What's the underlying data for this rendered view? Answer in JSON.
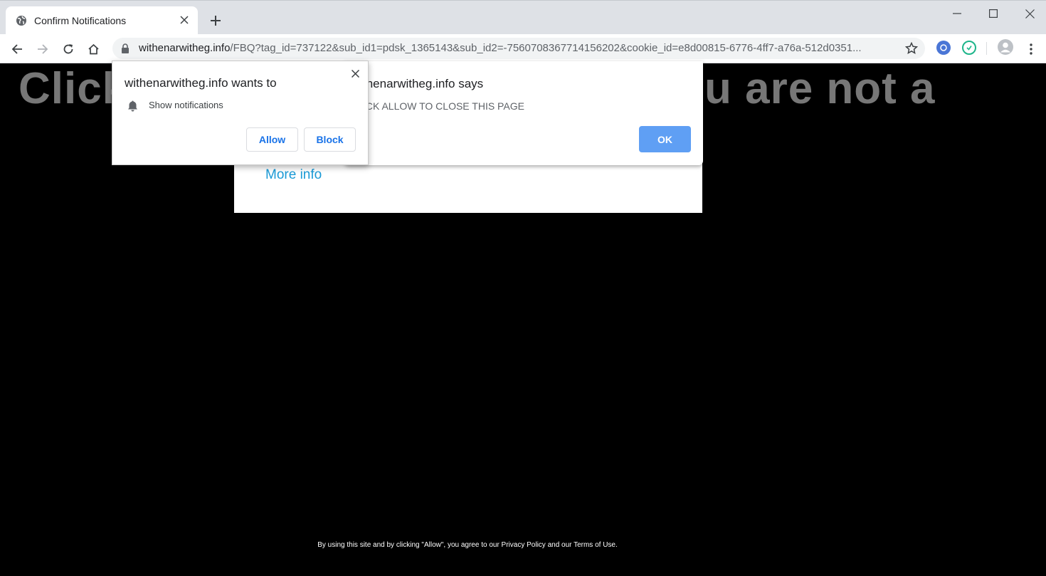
{
  "tab": {
    "title": "Confirm Notifications",
    "favicon": "globe-icon"
  },
  "window": {
    "minimize_icon": "minimize-icon",
    "maximize_icon": "maximize-icon",
    "close_icon": "close-icon"
  },
  "address_bar": {
    "host": "withenarwitheg.info",
    "path": "/FBQ?tag_id=737122&sub_id1=pdsk_1365143&sub_id2=-7560708367714156202&cookie_id=e8d00815-6776-4ff7-a76a-512d0351..."
  },
  "page": {
    "headline_left": "Click",
    "headline_right": "u are not a",
    "more_info": "More info",
    "footer": "By using this site and by clicking \"Allow\", you agree to our Privacy Policy and our Terms of Use."
  },
  "alert": {
    "title": "thenarwitheg.info says",
    "message": "ICK ALLOW TO CLOSE THIS PAGE",
    "ok_label": "OK",
    "ok_color": "#5f9ff4"
  },
  "permission": {
    "title": "withenarwitheg.info wants to",
    "item_label": "Show notifications",
    "allow_label": "Allow",
    "block_label": "Block",
    "accent": "#1a73e8"
  },
  "colors": {
    "tabbar": "#dee1e6",
    "page_bg": "#000000",
    "headline": "#777777",
    "link": "#1a9ad6"
  }
}
